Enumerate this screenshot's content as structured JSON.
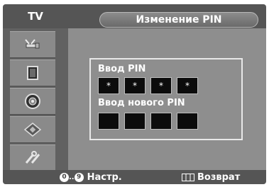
{
  "header": {
    "tab_label": "TV",
    "title": "Изменение PIN"
  },
  "sidebar": {
    "items": [
      {
        "icon": "antenna-icon"
      },
      {
        "icon": "picture-icon"
      },
      {
        "icon": "speaker-icon"
      },
      {
        "icon": "chip-icon"
      },
      {
        "icon": "tools-icon"
      }
    ]
  },
  "pin": {
    "enter_label": "Ввод PIN",
    "enter_values": [
      "*",
      "*",
      "*",
      "*"
    ],
    "new_label": "Ввод нового PIN",
    "new_values": [
      "",
      "",
      "",
      ""
    ]
  },
  "footer": {
    "digit_from": "0",
    "digit_sep": "..",
    "digit_to": "9",
    "setup_label": "Настр.",
    "return_label": "Возврат"
  },
  "colors": {
    "frame_bg": "#cfcfcf",
    "header_bg": "#555555",
    "panel_bg": "#8e8e8e",
    "cell_bg": "#0c0c0c"
  }
}
